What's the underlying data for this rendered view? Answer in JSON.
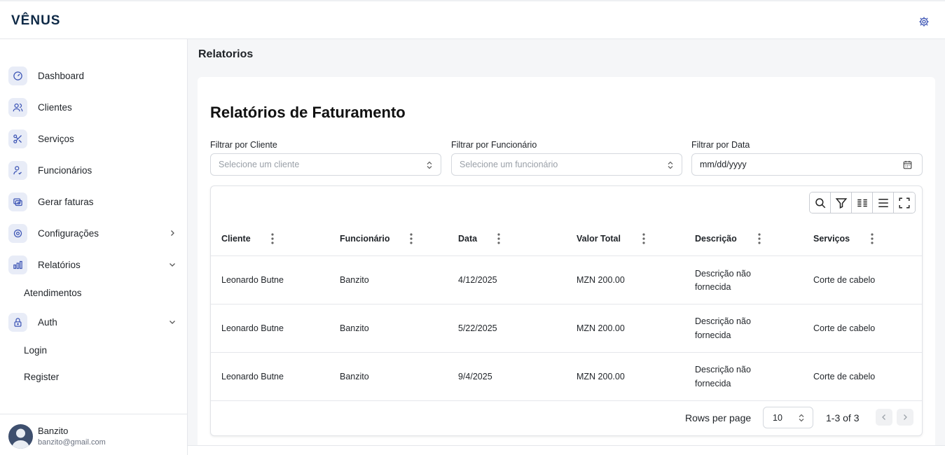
{
  "app": {
    "brand": "VÊNUS"
  },
  "sidebar": {
    "items": [
      {
        "label": "Dashboard",
        "icon": "dashboard-gauge-icon"
      },
      {
        "label": "Clientes",
        "icon": "users-icon"
      },
      {
        "label": "Serviços",
        "icon": "scissors-icon"
      },
      {
        "label": "Funcionários",
        "icon": "employee-icon"
      },
      {
        "label": "Gerar faturas",
        "icon": "invoice-icon"
      },
      {
        "label": "Configurações",
        "icon": "settings-icon"
      },
      {
        "label": "Relatórios",
        "icon": "bar-chart-icon"
      },
      {
        "label": "Auth",
        "icon": "lock-icon"
      }
    ],
    "relatorios_sub": [
      "Atendimentos"
    ],
    "auth_sub": [
      "Login",
      "Register"
    ],
    "user": {
      "name": "Banzito",
      "email": "banzito@gmail.com"
    }
  },
  "page": {
    "title": "Relatorios"
  },
  "card": {
    "title": "Relatórios de Faturamento",
    "filters": {
      "cliente": {
        "label": "Filtrar por Cliente",
        "placeholder": "Selecione um cliente"
      },
      "funcionario": {
        "label": "Filtrar por Funcionário",
        "placeholder": "Selecione um funcionário"
      },
      "data": {
        "label": "Filtrar por Data",
        "value": "mm/dd/yyyy"
      }
    }
  },
  "table": {
    "columns": [
      "Cliente",
      "Funcionário",
      "Data",
      "Valor Total",
      "Descrição",
      "Serviços"
    ],
    "rows": [
      {
        "cliente": "Leonardo Butne",
        "funcionario": "Banzito",
        "data": "4/12/2025",
        "valor": "MZN 200.00",
        "descricao_1": "Descrição não",
        "descricao_2": "fornecida",
        "servicos": "Corte de cabelo"
      },
      {
        "cliente": "Leonardo Butne",
        "funcionario": "Banzito",
        "data": "5/22/2025",
        "valor": "MZN 200.00",
        "descricao_1": "Descrição não",
        "descricao_2": "fornecida",
        "servicos": "Corte de cabelo"
      },
      {
        "cliente": "Leonardo Butne",
        "funcionario": "Banzito",
        "data": "9/4/2025",
        "valor": "MZN 200.00",
        "descricao_1": "Descrição não",
        "descricao_2": "fornecida",
        "servicos": "Corte de cabelo"
      }
    ],
    "pagination": {
      "rows_per_page_label": "Rows per page",
      "rows_per_page": "10",
      "count": "1-3 of 3"
    }
  },
  "colors": {
    "brand": "#0f2a47",
    "icon_accent": "#3d55b5",
    "icon_bg": "#e8ecf7"
  }
}
